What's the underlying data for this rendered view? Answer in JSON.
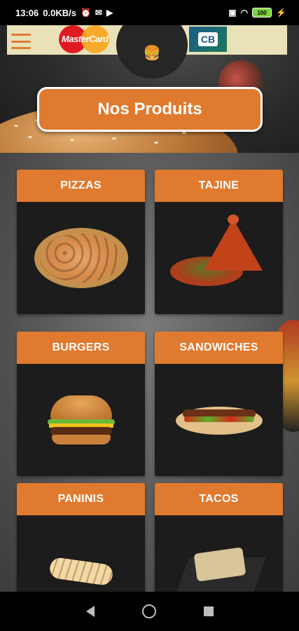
{
  "status_bar": {
    "time": "13:06",
    "network_speed": "0.0KB/s",
    "battery": "100"
  },
  "header": {
    "page_title": "Nos Produits",
    "mastercard_label": "MasterCard",
    "cb_label": "CB"
  },
  "categories": [
    {
      "label": "PIZZAS"
    },
    {
      "label": "TAJINE"
    },
    {
      "label": "BURGERS"
    },
    {
      "label": "SANDWICHES"
    },
    {
      "label": "PANINIS"
    },
    {
      "label": "TACOS"
    }
  ],
  "colors": {
    "accent": "#e07a2e",
    "card_bg": "#1c1c1c"
  }
}
